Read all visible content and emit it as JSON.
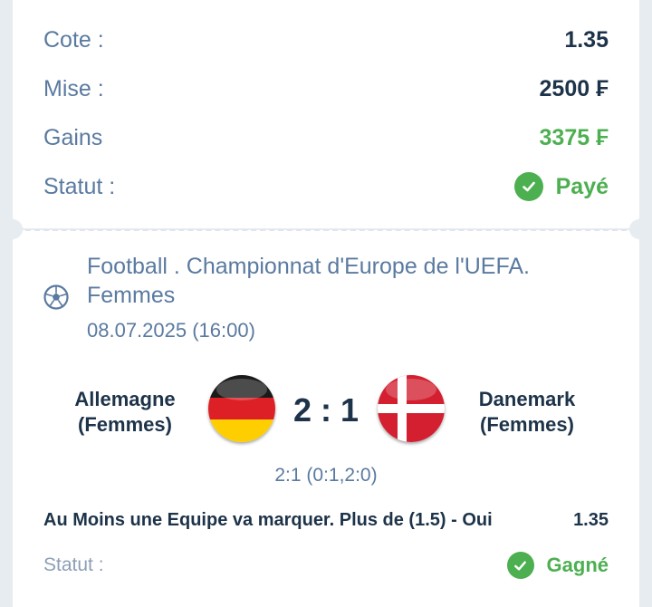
{
  "summary": {
    "odds_label": "Cote :",
    "odds_value": "1.35",
    "stake_label": "Mise :",
    "stake_value": "2500 ₣",
    "winnings_label": "Gains",
    "winnings_value": "3375 ₣",
    "status_label": "Statut :",
    "status_value": "Payé"
  },
  "event": {
    "title": "Football . Championnat d'Europe de l'UEFA. Femmes",
    "date": "08.07.2025 (16:00)",
    "home_team_line1": "Allemagne",
    "home_team_line2": "(Femmes)",
    "away_team_line1": "Danemark",
    "away_team_line2": "(Femmes)",
    "score": "2 : 1",
    "score_detail": "2:1 (0:1,2:0)"
  },
  "bet": {
    "selection": "Au Moins une Equipe va marquer. Plus de (1.5) - Oui",
    "odds": "1.35",
    "status_label": "Statut :",
    "status_value": "Gagné"
  },
  "icons": {
    "sport": "football-icon",
    "status_check": "check-circle-icon",
    "home_flag": "germany-flag-icon",
    "away_flag": "denmark-flag-icon"
  },
  "colors": {
    "label_blue": "#5a7aa0",
    "value_dark": "#1d3349",
    "success_green": "#4caf50"
  }
}
